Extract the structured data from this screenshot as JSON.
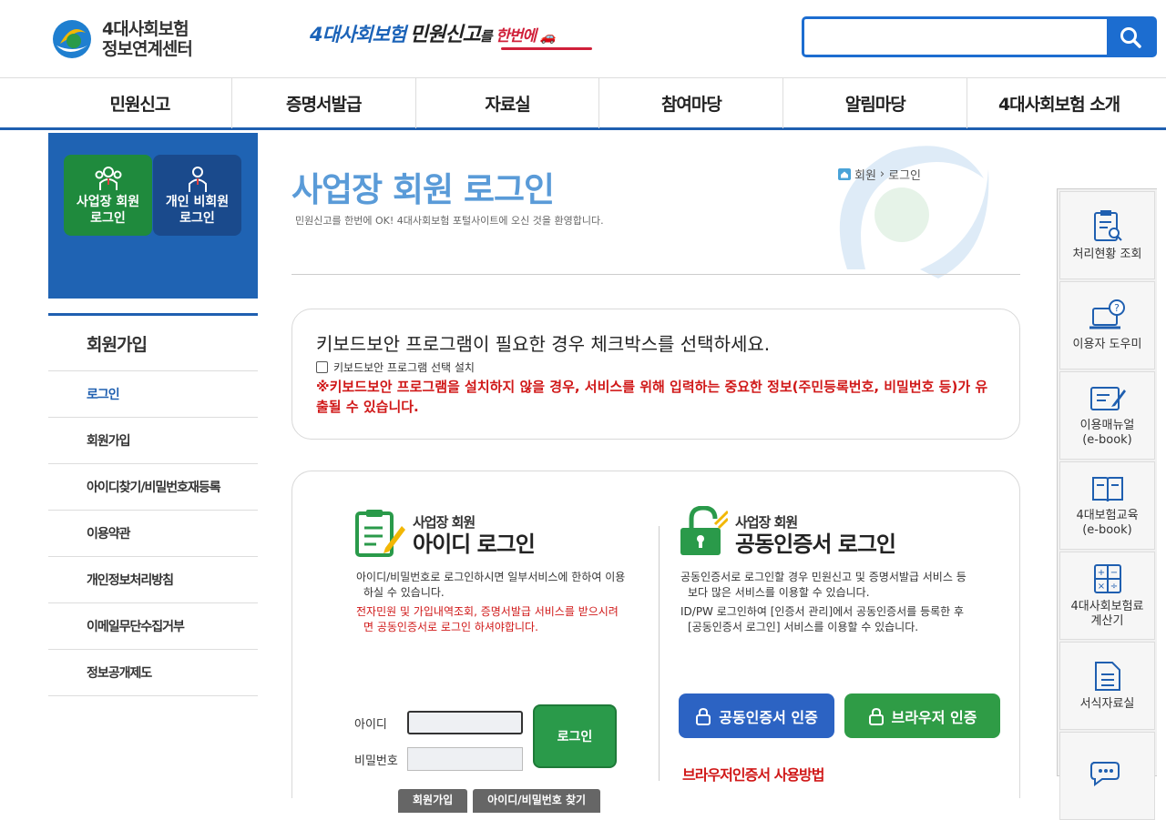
{
  "header": {
    "logo_line1": "4대사회보험",
    "logo_line2": "정보연계센터",
    "slogan_a": "4대사회보험",
    "slogan_b": "민원신고",
    "slogan_c": "를",
    "slogan_d": "한번에",
    "search_placeholder": ""
  },
  "gnb": [
    "민원신고",
    "증명서발급",
    "자료실",
    "참여마당",
    "알림마당",
    "4대사회보험 소개"
  ],
  "sidebar": {
    "biz_btn_line1": "사업장 회원",
    "biz_btn_line2": "로그인",
    "ind_btn_line1": "개인 비회원",
    "ind_btn_line2": "로그인",
    "title": "회원가입",
    "items": [
      "로그인",
      "회원가입",
      "아이디찾기/비밀번호재등록",
      "이용약관",
      "개인정보처리방침",
      "이메일무단수집거부",
      "정보공개제도"
    ]
  },
  "main": {
    "title": "사업장 회원 로그인",
    "desc": "민원신고를 한번에 OK! 4대사회보험 포털사이트에 오신 것을 환영합니다.",
    "breadcrumb": [
      "회원",
      "로그인"
    ]
  },
  "keyboard": {
    "heading": "키보드보안 프로그램이 필요한 경우 체크박스를 선택하세요.",
    "checkbox_label": "키보드보안 프로그램 선택 설치",
    "warning": "※키보드보안 프로그램을 설치하지 않을 경우, 서비스를 위해 입력하는 중요한 정보(주민등록번호, 비밀번호 등)가 유출될 수 있습니다."
  },
  "id_login": {
    "small": "사업장 회원",
    "big": "아이디 로그인",
    "bullet1": "아이디/비밀번호로 로그인하시면 일부서비스에 한하여 이용하실 수 있습니다.",
    "bullet2": "전자민원 및 가입내역조회, 증명서발급 서비스를 받으시려면 공동인증서로 로그인 하셔야합니다.",
    "id_label": "아이디",
    "pw_label": "비밀번호",
    "login_btn": "로그인",
    "join_btn": "회원가입",
    "find_btn": "아이디/비밀번호 찾기"
  },
  "cert_login": {
    "small": "사업장 회원",
    "big": "공동인증서 로그인",
    "bullet1": "공동인증서로 로그인할 경우 민원신고 및 증명서발급 서비스 등 보다 많은 서비스를 이용할 수 있습니다.",
    "bullet2": "ID/PW 로그인하여 [인증서 관리]에서 공동인증서를 등록한 후 [공동인증서 로그인] 서비스를 이용할 수 있습니다.",
    "cert_btn": "공동인증서 인증",
    "browser_btn": "브라우저 인증",
    "howto": "브라우저인증서 사용방법"
  },
  "quick": [
    "처리현황 조회",
    "이용자 도우미",
    "이용매뉴얼\n(e-book)",
    "4대보험교육\n(e-book)",
    "4대사회보험료\n계산기",
    "서식자료실",
    ""
  ],
  "colors": {
    "brand_blue": "#1f63b3",
    "green": "#2a9a4a",
    "red": "#d01818"
  }
}
